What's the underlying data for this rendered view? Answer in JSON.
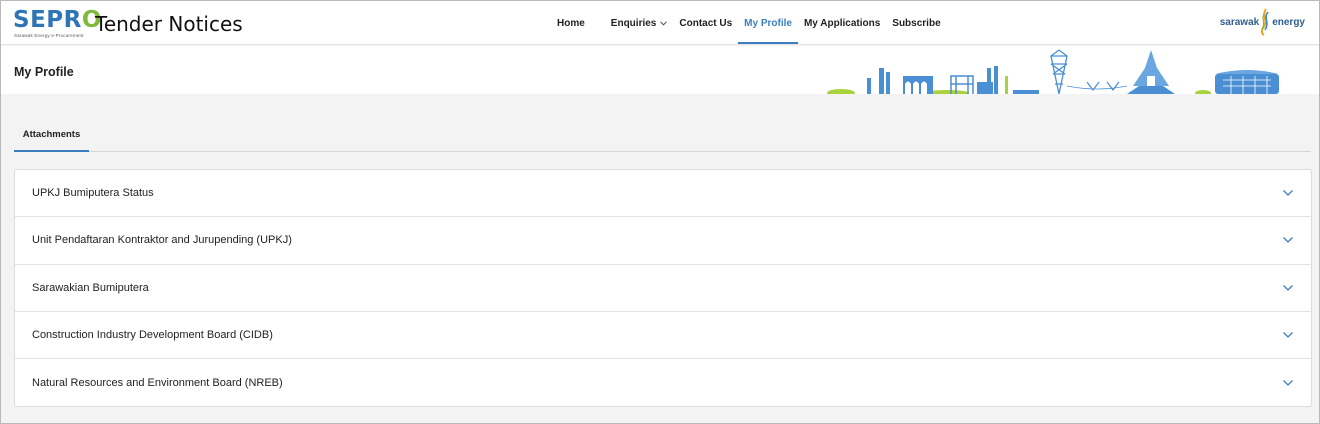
{
  "header": {
    "logo_text": "SEPRO",
    "logo_subtitle": "Sarawak Energy e-Procurement",
    "site_title": "Tender Notices",
    "brand_name_left": "sarawak",
    "brand_name_right": "energy",
    "nav": [
      {
        "label": "Home",
        "active": false
      },
      {
        "label": "Enquiries",
        "active": false,
        "has_dropdown": true
      },
      {
        "label": "Contact Us",
        "active": false
      },
      {
        "label": "My Profile",
        "active": true
      },
      {
        "label": "My Applications",
        "active": false
      },
      {
        "label": "Subscribe",
        "active": false
      }
    ]
  },
  "page": {
    "title": "My Profile"
  },
  "tabs": [
    {
      "label": "Attachments",
      "active": true
    }
  ],
  "accordion": [
    {
      "label": "UPKJ Bumiputera Status",
      "expanded": false
    },
    {
      "label": "Unit Pendaftaran Kontraktor and Jurupending (UPKJ)",
      "expanded": false
    },
    {
      "label": "Sarawakian Bumiputera",
      "expanded": false
    },
    {
      "label": "Construction Industry Development Board (CIDB)",
      "expanded": false
    },
    {
      "label": "Natural Resources and Environment Board (NREB)",
      "expanded": false
    }
  ],
  "colors": {
    "accent": "#3b7fc0",
    "logo_blue": "#2f74b5",
    "logo_green": "#7fb93d",
    "skyline_blue": "#4a8fd4",
    "skyline_green": "#a9d23c",
    "background": "#f3f3f3"
  },
  "icons": {
    "nav_dropdown": "chevron-down-icon",
    "accordion_toggle": "chevron-down-icon",
    "brand_mark": "energy-swirl-icon",
    "banner_art": "skyline-illustration"
  }
}
